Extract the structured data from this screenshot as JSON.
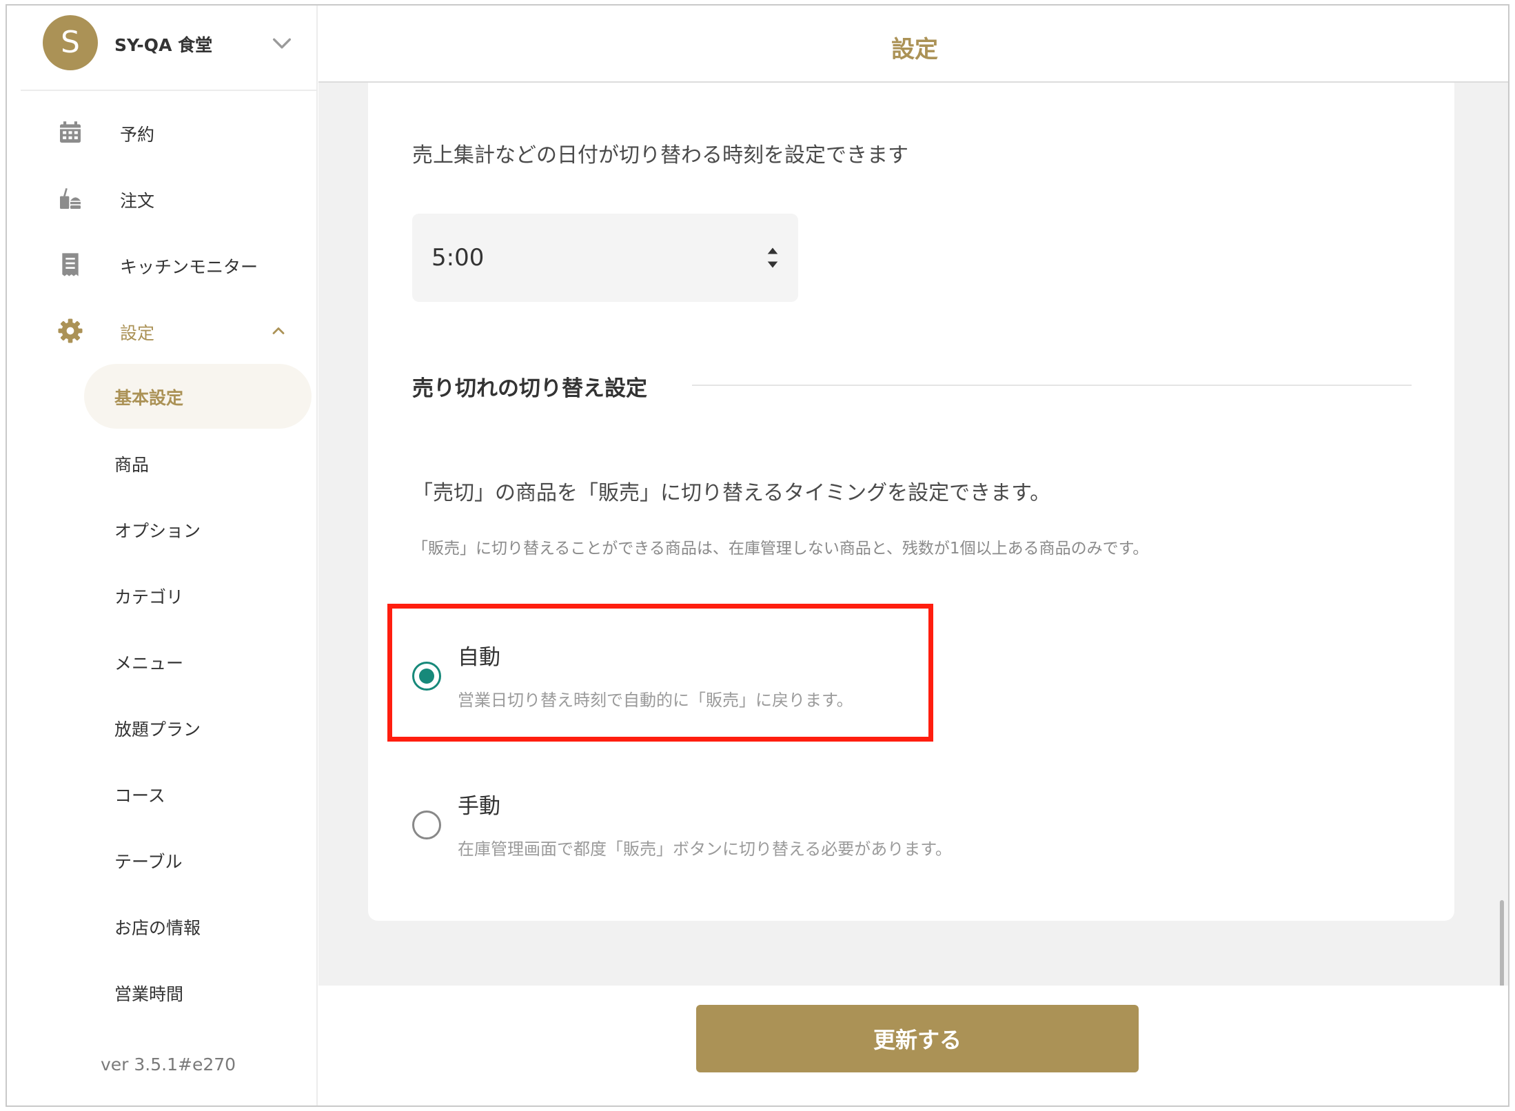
{
  "shop": {
    "initial": "S",
    "name": "SY-QA 食堂"
  },
  "nav": {
    "reservation": "予約",
    "order": "注文",
    "kitchen": "キッチンモニター",
    "settings": "設定"
  },
  "settings_sub": [
    "基本設定",
    "商品",
    "オプション",
    "カテゴリ",
    "メニュー",
    "放題プラン",
    "コース",
    "テーブル",
    "お店の情報",
    "営業時間"
  ],
  "version": "ver 3.5.1#e270",
  "header": {
    "title": "設定"
  },
  "day_change": {
    "description": "売上集計などの日付が切り替わる時刻を設定できます",
    "time_value": "5:00"
  },
  "soldout": {
    "section_title": "売り切れの切り替え設定",
    "description": "「売切」の商品を「販売」に切り替えるタイミングを設定できます。",
    "note": "「販売」に切り替えることができる商品は、在庫管理しない商品と、残数が1個以上ある商品のみです。",
    "options": [
      {
        "label": "自動",
        "description": "営業日切り替え時刻で自動的に「販売」に戻ります。",
        "checked": true
      },
      {
        "label": "手動",
        "description": "在庫管理画面で都度「販売」ボタンに切り替える必要があります。",
        "checked": false
      }
    ]
  },
  "footer": {
    "update_label": "更新する"
  },
  "colors": {
    "accent": "#ab9256",
    "radio": "#17897a",
    "highlight": "#ff1e0f"
  }
}
